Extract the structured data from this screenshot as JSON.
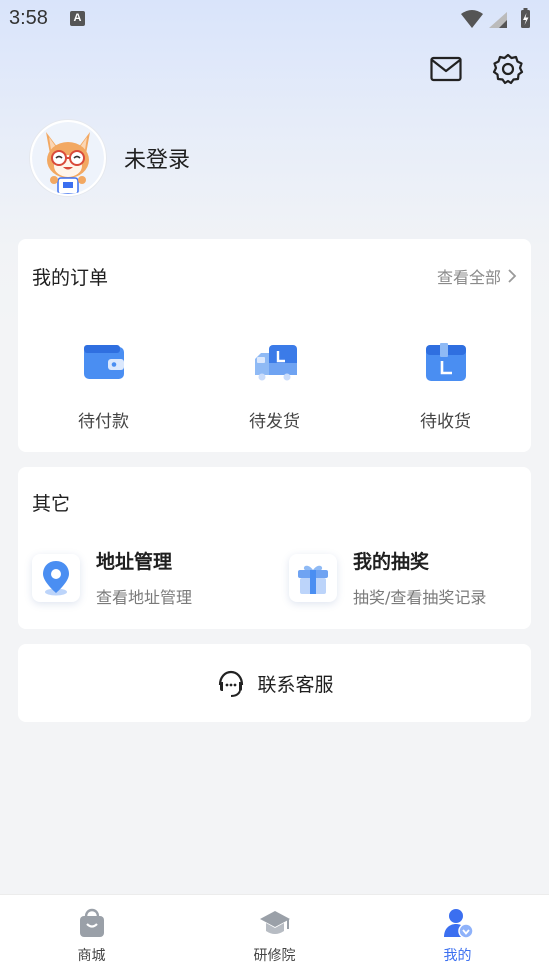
{
  "status_bar": {
    "time": "3:58",
    "indicator": "A"
  },
  "header": {
    "mail_icon": "mail-icon",
    "settings_icon": "gear-icon"
  },
  "profile": {
    "login_text": "未登录"
  },
  "orders": {
    "title": "我的订单",
    "view_all": "查看全部",
    "items": [
      {
        "label": "待付款",
        "icon": "wallet-icon"
      },
      {
        "label": "待发货",
        "icon": "truck-icon"
      },
      {
        "label": "待收货",
        "icon": "box-icon"
      }
    ]
  },
  "other": {
    "title": "其它",
    "items": [
      {
        "title": "地址管理",
        "subtitle": "查看地址管理",
        "icon": "location-pin-icon"
      },
      {
        "title": "我的抽奖",
        "subtitle": "抽奖/查看抽奖记录",
        "icon": "gift-icon"
      }
    ]
  },
  "service": {
    "label": "联系客服",
    "icon": "headset-icon"
  },
  "tabbar": {
    "items": [
      {
        "label": "商城",
        "icon": "shopping-bag-icon",
        "active": false
      },
      {
        "label": "研修院",
        "icon": "graduation-cap-icon",
        "active": false
      },
      {
        "label": "我的",
        "icon": "user-icon",
        "active": true
      }
    ]
  },
  "colors": {
    "accent": "#3b6ff0",
    "icon_blue": "#4a8ef2",
    "background": "#f3f4f6"
  }
}
